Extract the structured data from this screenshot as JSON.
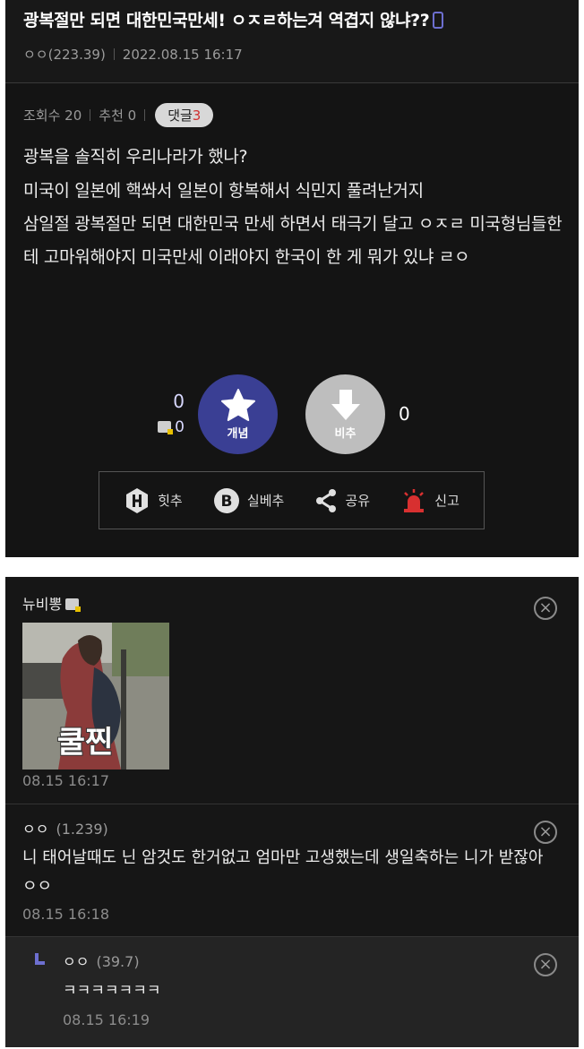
{
  "post": {
    "title": "광복절만 되면 대한민국만세! ㅇㅈㄹ하는겨 역겹지 않냐??",
    "author": "ㅇㅇ(223.39)",
    "datetime": "2022.08.15 16:17",
    "views": "조회수 20",
    "recommend": "추천 0",
    "comment_label": "댓글",
    "comment_count": "3",
    "body": [
      "광복을 솔직히 우리나라가 했나?",
      "미국이 일본에 핵쏴서 일본이 항복해서 식민지 풀려난거지",
      "삼일절 광복절만 되면 대한민국 만세 하면서 태극기 달고 ㅇㅈㄹ 미국형님들한테 고마워해야지 미국만세 이래야지 한국이 한 게 뭐가 있냐 ㄹㅇ"
    ]
  },
  "vote": {
    "up_count": "0",
    "fixed_up_count": "0",
    "up_label": "개념",
    "down_label": "비추",
    "down_count": "0"
  },
  "actions": {
    "hit": "힛추",
    "best": "실베추",
    "share": "공유",
    "report": "신고"
  },
  "comments": [
    {
      "nick": "뉴비뽕",
      "image_caption": "쿨찐",
      "date": "08.15 16:17"
    },
    {
      "nick": "ㅇㅇ",
      "ip": "(1.239)",
      "text": "니 태어날때도 닌 암것도 한거없고 엄마만 고생했는데 생일축하는 니가 받잖아 ㅇㅇ",
      "date": "08.15 16:18"
    },
    {
      "nick": "ㅇㅇ",
      "ip": "(39.7)",
      "text": "ㅋㅋㅋㅋㅋㅋㅋ",
      "date": "08.15 16:19"
    }
  ],
  "colors": {
    "accent": "#3a3f94",
    "report": "#d83030",
    "background": "#141414"
  }
}
